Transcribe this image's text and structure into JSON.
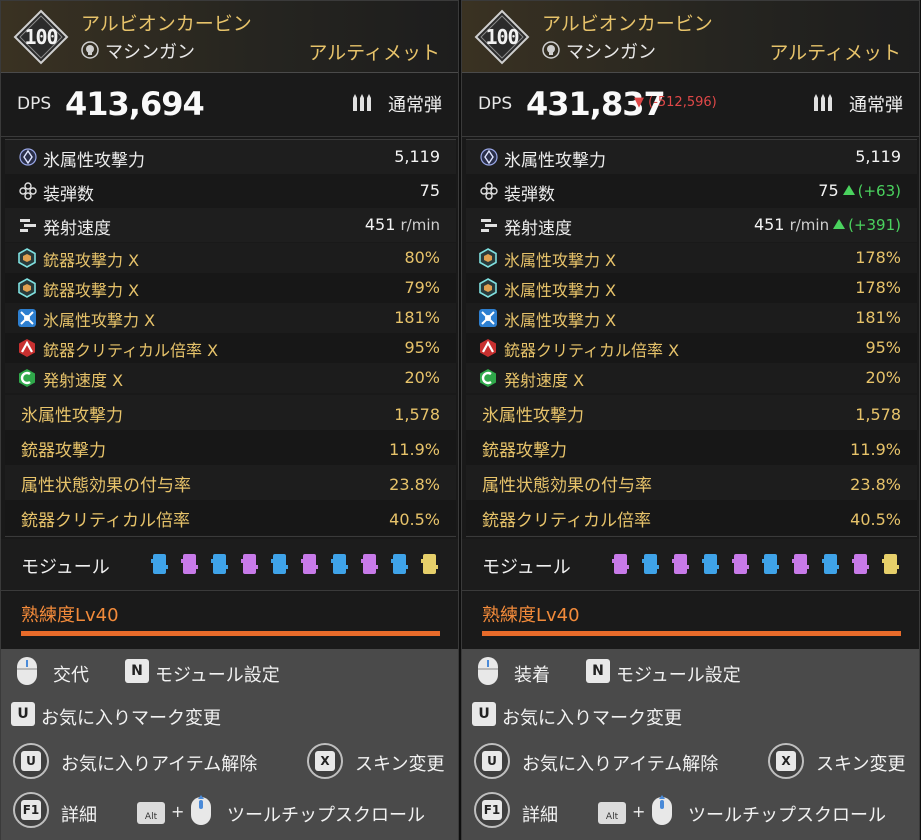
{
  "panels": [
    {
      "level": "100",
      "weapon_name": "アルビオンカービン",
      "weapon_type": "マシンガン",
      "weapon_type_icon": "skull-icon",
      "rarity": "アルティメット",
      "dps_label": "DPS",
      "dps_value": "413,694",
      "dps_delta": "",
      "ammo_icon": "bullets-icon",
      "ammo_label": "通常弾",
      "basic_stats": [
        {
          "label": "氷属性攻撃力",
          "value": "5,119",
          "unit": "",
          "delta": "",
          "icon": "ice-attribute-icon"
        },
        {
          "label": "装弾数",
          "value": "75",
          "unit": "",
          "delta": "",
          "icon": "magazine-icon"
        },
        {
          "label": "発射速度",
          "value": "451",
          "unit": "r/min",
          "delta": "",
          "icon": "fire-rate-icon"
        }
      ],
      "sub_stats": [
        {
          "label": "銃器攻撃力 X",
          "value": "80%",
          "icon": "hexagon-cyan-icon"
        },
        {
          "label": "銃器攻撃力 X",
          "value": "79%",
          "icon": "hexagon-cyan-icon"
        },
        {
          "label": "氷属性攻撃力 X",
          "value": "181%",
          "icon": "ice-burst-blue-icon"
        },
        {
          "label": "銃器クリティカル倍率 X",
          "value": "95%",
          "icon": "critical-red-icon"
        },
        {
          "label": "発射速度 X",
          "value": "20%",
          "icon": "fire-rate-green-icon"
        }
      ],
      "extra_stats": [
        {
          "label": "氷属性攻撃力",
          "value": "1,578"
        },
        {
          "label": "銃器攻撃力",
          "value": "11.9%"
        },
        {
          "label": "属性状態効果の付与率",
          "value": "23.8%"
        },
        {
          "label": "銃器クリティカル倍率",
          "value": "40.5%"
        }
      ],
      "module_label": "モジュール",
      "module_slots": [
        "blue",
        "purple",
        "blue",
        "purple",
        "blue",
        "purple",
        "blue",
        "purple",
        "blue",
        "yellow"
      ],
      "proficiency_label": "熟練度Lv40",
      "proficiency_fraction": 1.0,
      "keys": {
        "mouse_action": "交代",
        "n_key": "N",
        "n_action": "モジュール設定",
        "u_key": "U",
        "u_action": "お気に入りマーク変更",
        "u_round_key": "U",
        "u_round_action": "お気に入りアイテム解除",
        "x_key": "X",
        "x_action": "スキン変更",
        "f1_key": "F1",
        "f1_action": "詳細",
        "alt_key": "Alt",
        "plus": "+",
        "scroll_action": "ツールチップスクロール"
      }
    },
    {
      "level": "100",
      "weapon_name": "アルビオンカービン",
      "weapon_type": "マシンガン",
      "weapon_type_icon": "skull-icon",
      "rarity": "アルティメット",
      "dps_label": "DPS",
      "dps_value": "431,837",
      "dps_delta": "▼ (-512,596)",
      "ammo_icon": "bullets-icon",
      "ammo_label": "通常弾",
      "basic_stats": [
        {
          "label": "氷属性攻撃力",
          "value": "5,119",
          "unit": "",
          "delta": "",
          "icon": "ice-attribute-icon"
        },
        {
          "label": "装弾数",
          "value": "75",
          "unit": "",
          "delta": "(+63)",
          "icon": "magazine-icon"
        },
        {
          "label": "発射速度",
          "value": "451",
          "unit": "r/min",
          "delta": "(+391)",
          "icon": "fire-rate-icon"
        }
      ],
      "sub_stats": [
        {
          "label": "氷属性攻撃力 X",
          "value": "178%",
          "icon": "hexagon-cyan-icon"
        },
        {
          "label": "氷属性攻撃力 X",
          "value": "178%",
          "icon": "hexagon-cyan-icon"
        },
        {
          "label": "氷属性攻撃力 X",
          "value": "181%",
          "icon": "ice-burst-blue-icon"
        },
        {
          "label": "銃器クリティカル倍率 X",
          "value": "95%",
          "icon": "critical-red-icon"
        },
        {
          "label": "発射速度 X",
          "value": "20%",
          "icon": "fire-rate-green-icon"
        }
      ],
      "extra_stats": [
        {
          "label": "氷属性攻撃力",
          "value": "1,578"
        },
        {
          "label": "銃器攻撃力",
          "value": "11.9%"
        },
        {
          "label": "属性状態効果の付与率",
          "value": "23.8%"
        },
        {
          "label": "銃器クリティカル倍率",
          "value": "40.5%"
        }
      ],
      "module_label": "モジュール",
      "module_slots": [
        "purple",
        "blue",
        "purple",
        "blue",
        "purple",
        "blue",
        "purple",
        "blue",
        "purple",
        "yellow"
      ],
      "proficiency_label": "熟練度Lv40",
      "proficiency_fraction": 1.0,
      "keys": {
        "mouse_action": "装着",
        "n_key": "N",
        "n_action": "モジュール設定",
        "u_key": "U",
        "u_action": "お気に入りマーク変更",
        "u_round_key": "U",
        "u_round_action": "お気に入りアイテム解除",
        "x_key": "X",
        "x_action": "スキン変更",
        "f1_key": "F1",
        "f1_action": "詳細",
        "alt_key": "Alt",
        "plus": "+",
        "scroll_action": "ツールチップスクロール"
      }
    }
  ],
  "colors": {
    "gold": "#e7c36a",
    "orange": "#f28a3a",
    "increase_green": "#4ad25e",
    "decrease_red": "#e04848",
    "module_blue": "#3fa3e8",
    "module_purple": "#c77ae8",
    "module_yellow": "#e6cf6a"
  }
}
